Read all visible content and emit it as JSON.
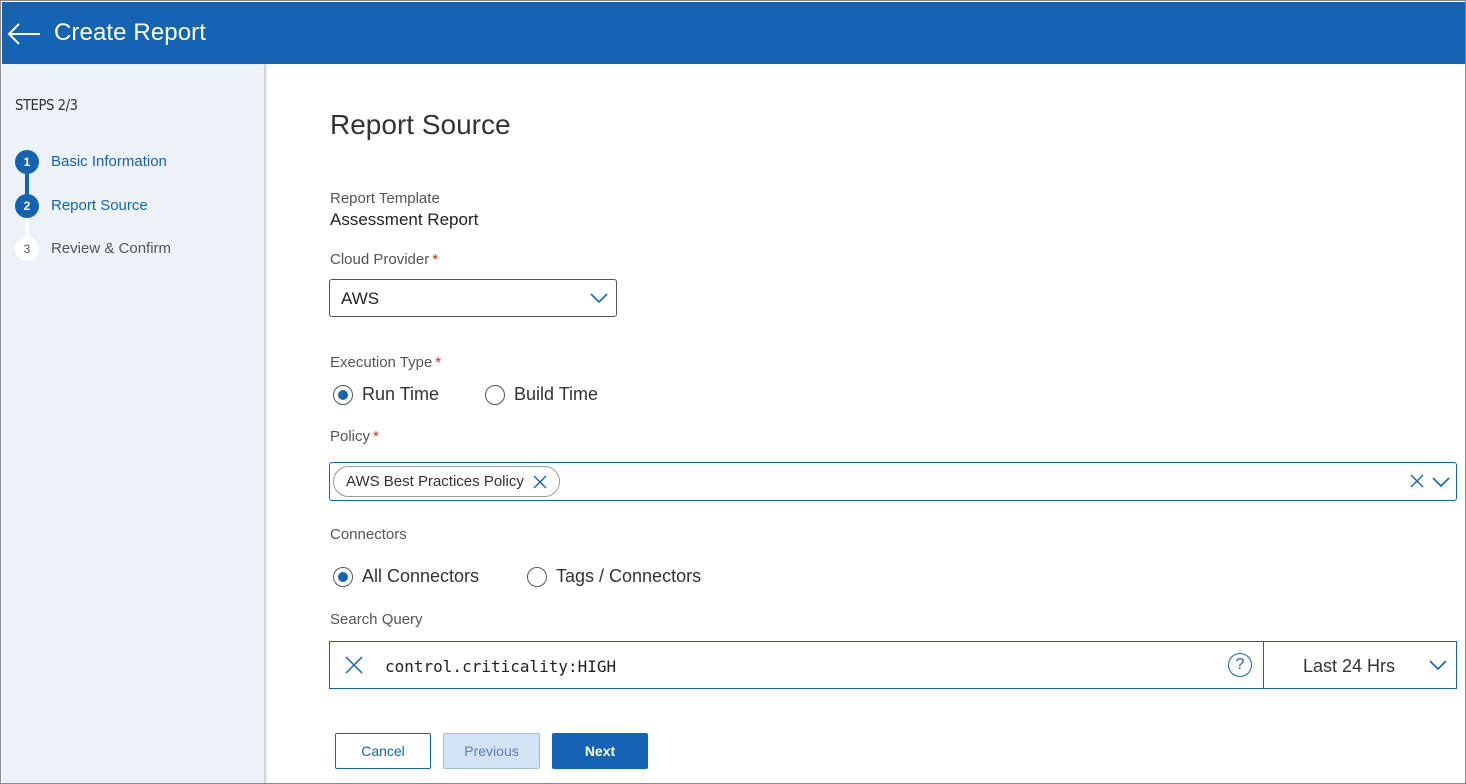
{
  "header": {
    "title": "Create Report",
    "back_icon": "arrow-left-icon"
  },
  "sidebar": {
    "heading": "STEPS 2/3",
    "steps": [
      {
        "number": "1",
        "label": "Basic Information",
        "state": "completed"
      },
      {
        "number": "2",
        "label": "Report Source",
        "state": "current"
      },
      {
        "number": "3",
        "label": "Review & Confirm",
        "state": "pending"
      }
    ]
  },
  "main": {
    "title": "Report Source",
    "report_template": {
      "label": "Report Template",
      "value": "Assessment Report"
    },
    "cloud_provider": {
      "label": "Cloud Provider",
      "required_mark": "*",
      "selected": "AWS"
    },
    "execution_type": {
      "label": "Execution Type",
      "required_mark": "*",
      "options": [
        {
          "label": "Run Time",
          "selected": true
        },
        {
          "label": "Build Time",
          "selected": false
        }
      ]
    },
    "policy": {
      "label": "Policy",
      "required_mark": "*",
      "chips": [
        "AWS Best Practices Policy"
      ]
    },
    "connectors": {
      "label": "Connectors",
      "options": [
        {
          "label": "All Connectors",
          "selected": true
        },
        {
          "label": "Tags / Connectors",
          "selected": false
        }
      ]
    },
    "search_query": {
      "label": "Search Query",
      "value": "control.criticality:HIGH",
      "help_glyph": "?",
      "time_range": "Last 24 Hrs"
    }
  },
  "footer": {
    "cancel_label": "Cancel",
    "previous_label": "Previous",
    "next_label": "Next"
  },
  "colors": {
    "primary": "#1564b3",
    "sidebar_bg": "#edf1f8",
    "required": "#d12b2b",
    "previous_bg": "#d3e3f5"
  }
}
